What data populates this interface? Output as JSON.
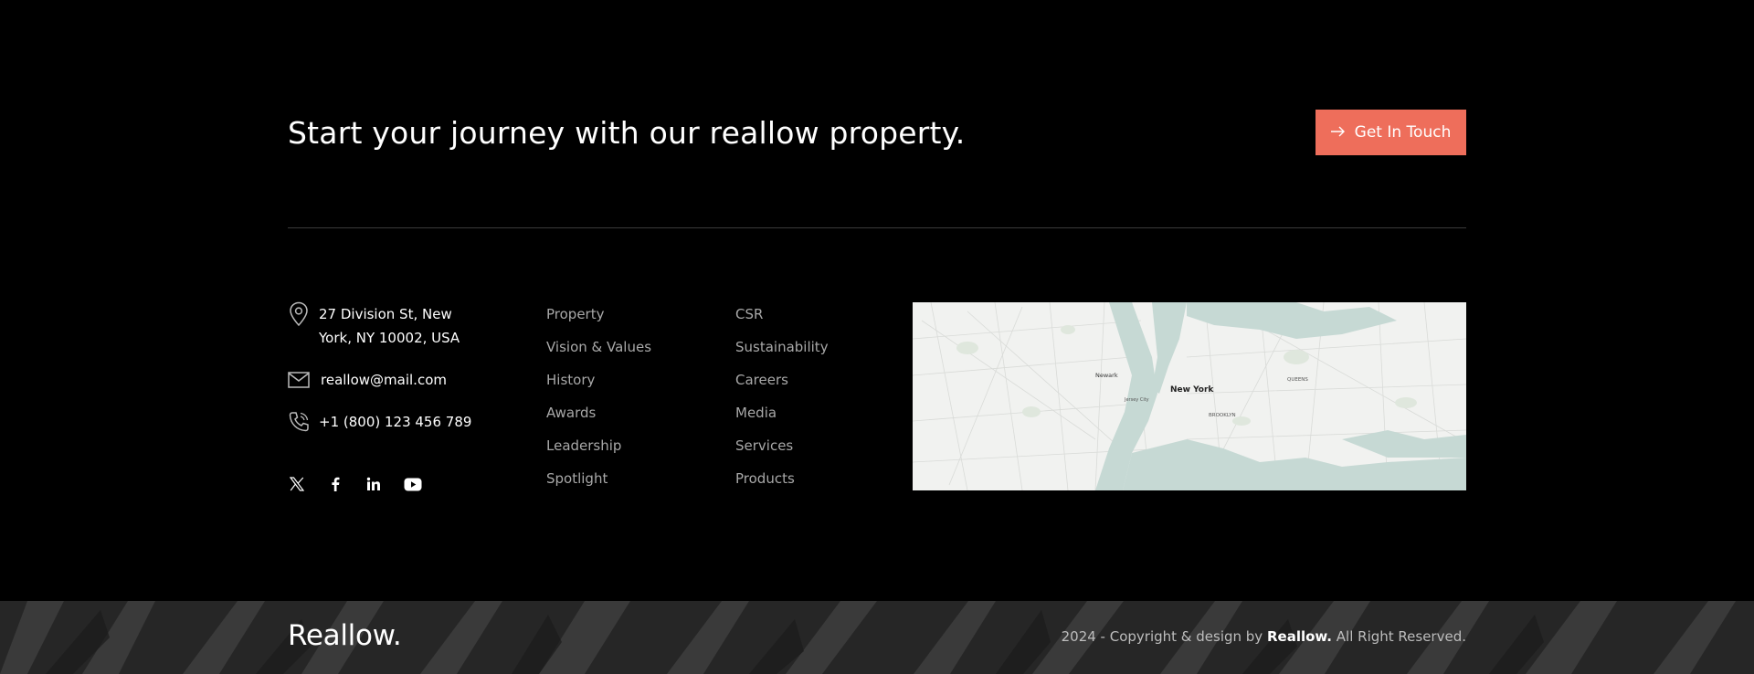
{
  "cta": {
    "title": "Start your journey with our reallow property.",
    "button_label": "Get In Touch",
    "button_color": "#ee6e5b"
  },
  "contact": {
    "address_line1": "27 Division St, New",
    "address_line2": "York, NY 10002, USA",
    "email": "reallow@mail.com",
    "phone": "+1 (800) 123 456 789",
    "icons": [
      "map-pin-icon",
      "mail-icon",
      "phone-icon"
    ]
  },
  "social": [
    "x-icon",
    "facebook-icon",
    "linkedin-icon",
    "youtube-icon"
  ],
  "links_col1": [
    "Property",
    "Vision & Values",
    "History",
    "Awards",
    "Leadership",
    "Spotlight"
  ],
  "links_col2": [
    "CSR",
    "Sustainability",
    "Careers",
    "Media",
    "Services",
    "Products"
  ],
  "map": {
    "city_label": "New York",
    "labels": [
      "Newark",
      "QUEENS",
      "BROOKLYN",
      "Jersey City"
    ]
  },
  "footer": {
    "logo": "Reallow.",
    "copyright_prefix": "2024 - Copyright & design by",
    "brand": "Reallow.",
    "copyright_suffix": "All Right Reserved."
  }
}
